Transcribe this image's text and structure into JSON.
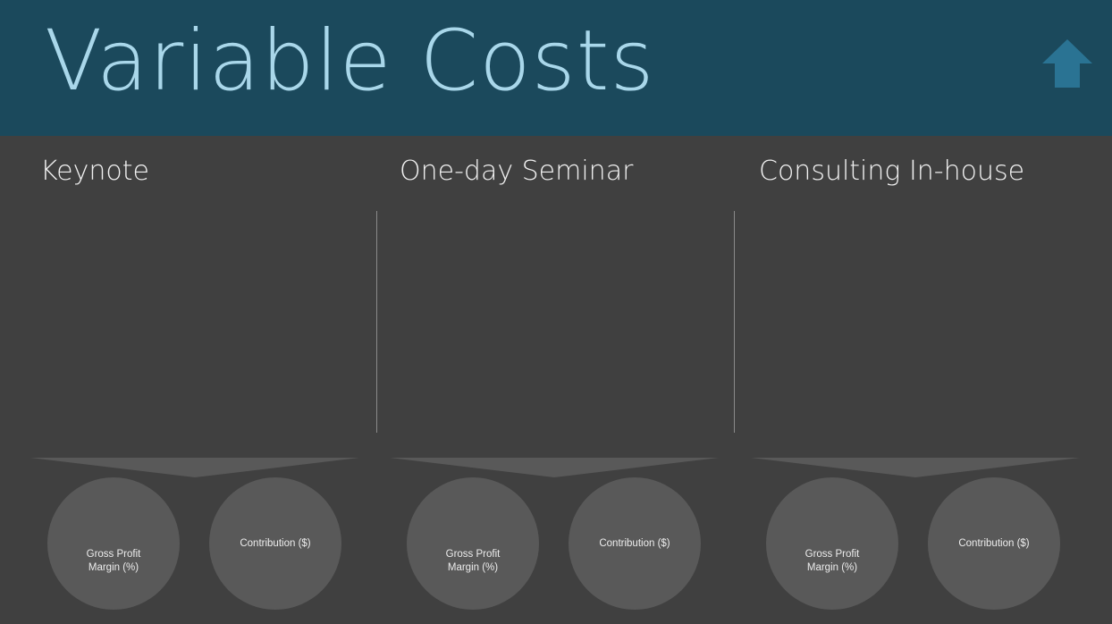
{
  "header": {
    "title": "Variable Costs",
    "up_icon": "up-arrow-icon"
  },
  "columns": [
    {
      "heading": "Keynote",
      "metrics": [
        {
          "label": "Gross Profit\nMargin (%)"
        },
        {
          "label": "Contribution ($)"
        }
      ]
    },
    {
      "heading": "One-day Seminar",
      "metrics": [
        {
          "label": "Gross Profit\nMargin (%)"
        },
        {
          "label": "Contribution ($)"
        }
      ]
    },
    {
      "heading": "Consulting In-house",
      "metrics": [
        {
          "label": "Gross Profit\nMargin (%)"
        },
        {
          "label": "Contribution ($)"
        }
      ]
    }
  ],
  "colors": {
    "header_bg": "#1b495c",
    "title": "#a9d7ea",
    "arrow": "#2a7393",
    "body_bg": "#404040",
    "circle": "#595959"
  }
}
